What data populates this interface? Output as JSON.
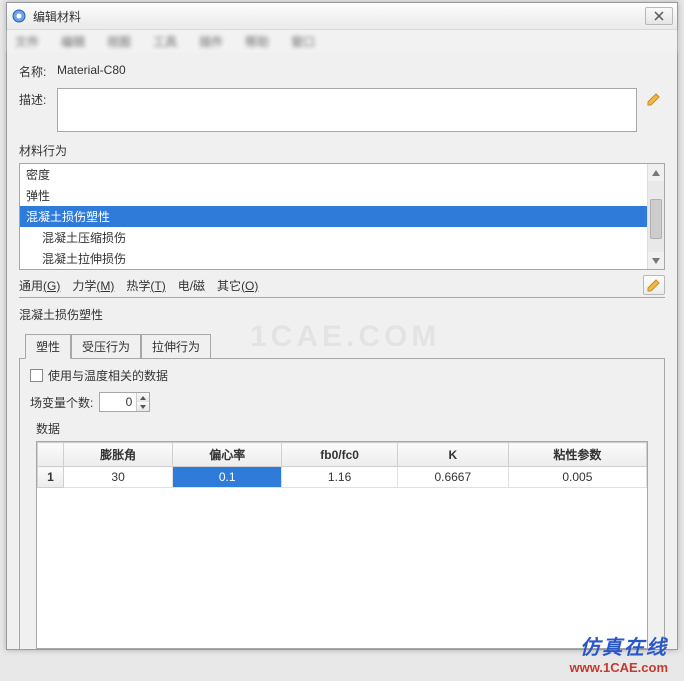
{
  "window": {
    "title": "编辑材料"
  },
  "form": {
    "name_label": "名称:",
    "name_value": "Material-C80",
    "desc_label": "描述:",
    "behavior_label": "材料行为"
  },
  "behaviors": {
    "items": [
      "密度",
      "弹性",
      "混凝土损伤塑性",
      "混凝土压缩损伤",
      "混凝土拉伸损伤"
    ],
    "selected_index": 2
  },
  "menus": {
    "general": "通用",
    "general_key": "(G)",
    "mechanics": "力学",
    "mechanics_key": "(M)",
    "thermal": "热学",
    "thermal_key": "(T)",
    "em": "电/磁",
    "other": "其它",
    "other_key": "(O)"
  },
  "plasticity": {
    "title": "混凝土损伤塑性",
    "tabs": [
      "塑性",
      "受压行为",
      "拉伸行为"
    ],
    "active_tab": 0,
    "temp_checkbox": "使用与温度相关的数据",
    "fieldvar_label": "场变量个数:",
    "fieldvar_value": "0",
    "data_label": "数据"
  },
  "table": {
    "headers": [
      "膨胀角",
      "偏心率",
      "fb0/fc0",
      "K",
      "粘性参数"
    ],
    "row_index": "1",
    "row": [
      "30",
      "0.1",
      "1.16",
      "0.6667",
      "0.005"
    ],
    "selected_col": 1
  },
  "branding": {
    "watermark": "1CAE.COM",
    "cn": "仿真在线",
    "url": "www.1CAE.com"
  }
}
